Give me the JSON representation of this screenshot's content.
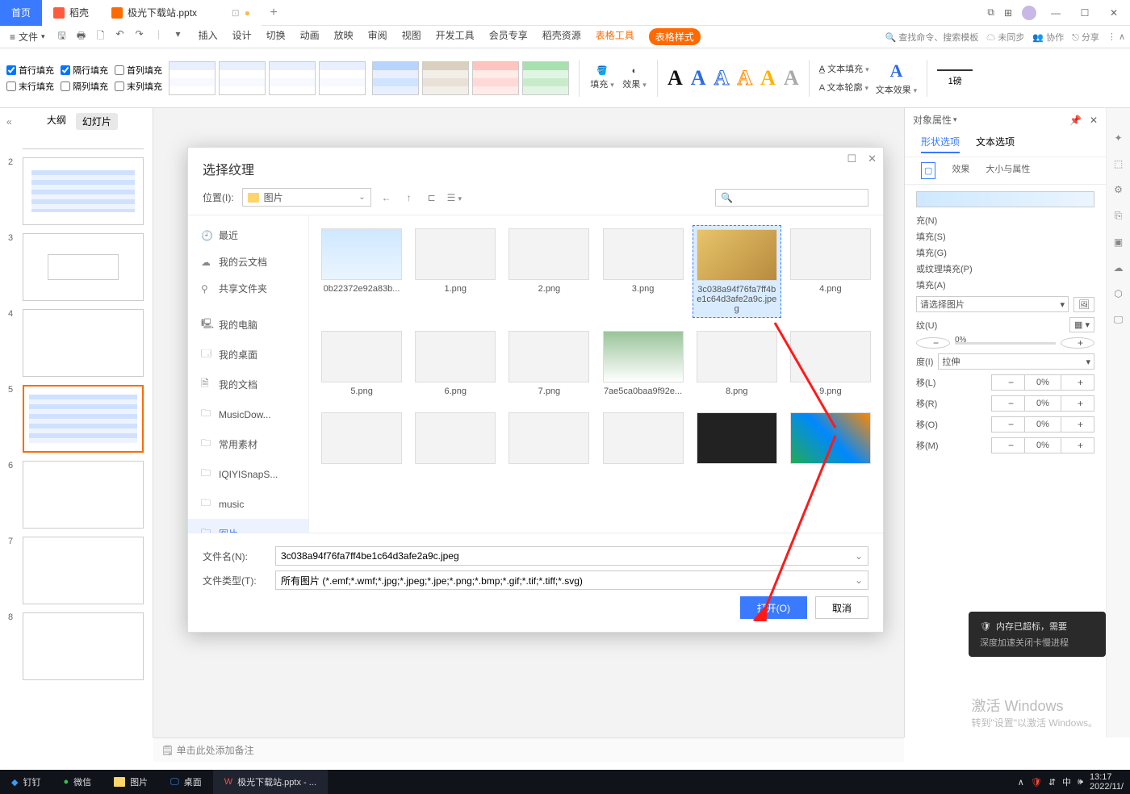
{
  "titlebar": {
    "home": "首页",
    "doke": "稻壳",
    "file_tab": "极光下载站.pptx",
    "add": "+"
  },
  "menubar": {
    "file": "文件",
    "tabs": [
      "插入",
      "设计",
      "切换",
      "动画",
      "放映",
      "审阅",
      "视图",
      "开发工具",
      "会员专享",
      "稻壳资源"
    ],
    "table_tools": "表格工具",
    "table_style": "表格样式",
    "search_cmd": "查找命令、搜索模板",
    "unsync": "未同步",
    "collab": "协作",
    "share": "分享"
  },
  "ribbon": {
    "checks": [
      "首行填充",
      "隔行填充",
      "首列填充",
      "末行填充",
      "隔列填充",
      "末列填充"
    ],
    "fill": "填充",
    "effect": "效果",
    "text_fill": "文本填充",
    "text_outline": "文本轮廓",
    "text_effect": "文本效果",
    "stroke": "1磅"
  },
  "left": {
    "outline": "大纲",
    "slides": "幻灯片",
    "nums": [
      "2",
      "3",
      "4",
      "5",
      "6",
      "7",
      "8"
    ]
  },
  "dialog": {
    "title": "选择纹理",
    "location_lbl": "位置(I):",
    "location_val": "图片",
    "sidebar": {
      "recent": "最近",
      "cloud": "我的云文档",
      "shared": "共享文件夹",
      "computer": "我的电脑",
      "desktop": "我的桌面",
      "docs": "我的文档",
      "musicdow": "MusicDow...",
      "material": "常用素材",
      "iqiyi": "IQIYISnapS...",
      "music": "music",
      "pictures": "图片"
    },
    "files": [
      "0b22372e92a83b...",
      "1.png",
      "2.png",
      "3.png",
      "3c038a94f76fa7ff4be1c64d3afe2a9c.jpeg",
      "4.png",
      "5.png",
      "6.png",
      "7.png",
      "7ae5ca0baa9f92e...",
      "8.png",
      "9.png"
    ],
    "filename_lbl": "文件名(N):",
    "filename_val": "3c038a94f76fa7ff4be1c64d3afe2a9c.jpeg",
    "filetype_lbl": "文件类型(T):",
    "filetype_val": "所有图片 (*.emf;*.wmf;*.jpg;*.jpeg;*.jpe;*.png;*.bmp;*.gif;*.tif;*.tiff;*.svg)",
    "open": "打开(O)",
    "cancel": "取消"
  },
  "right": {
    "header": "对象属性",
    "tab_shape": "形状选项",
    "tab_text": "文本选项",
    "sub_effect": "效果",
    "sub_size": "大小与属性",
    "radios": [
      "充(N)",
      "填充(S)",
      "填充(G)",
      "或纹理填充(P)",
      "填充(A)"
    ],
    "pic_select": "请选择图片",
    "texture_u": "纹(U)",
    "opacity_label": "0%",
    "tile_l": "移(L)",
    "tile_ill": "拉伸",
    "tile_ill_lbl": "度(I)",
    "tile_r": "移(R)",
    "tile_o": "移(O)",
    "tile_m": "移(M)",
    "zero": "0%"
  },
  "notes": "单击此处添加备注",
  "activation": {
    "l1": "激活 Windows",
    "l2": "转到\"设置\"以激活 Windows。"
  },
  "notification": {
    "l1": "内存已超标，需要",
    "l2": "深度加速关闭卡慢进程"
  },
  "taskbar": {
    "dingtalk": "钉钉",
    "wechat": "微信",
    "pictures": "图片",
    "desktop": "桌面",
    "pptx": "极光下载站.pptx - ...",
    "time": "13:17",
    "date": "2022/11/",
    "ime": "中"
  }
}
